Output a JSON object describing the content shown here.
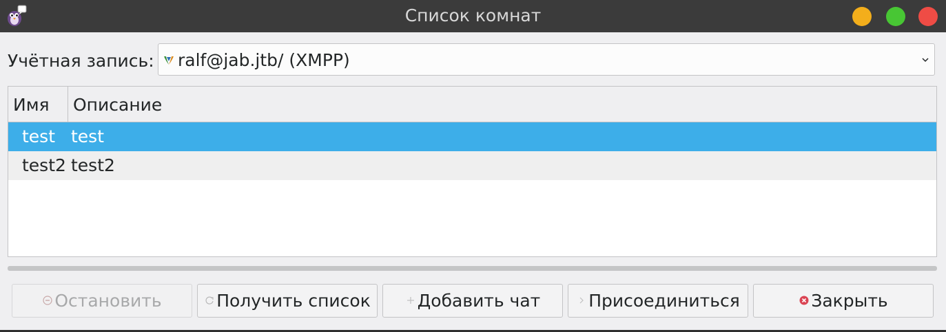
{
  "window": {
    "title": "Список комнат"
  },
  "account": {
    "label": "Учётная запись:",
    "value": "ralf@jab.jtb/ (XMPP)"
  },
  "table": {
    "columns": [
      "Имя",
      "Описание"
    ],
    "rows": [
      {
        "name": "test",
        "description": "test",
        "selected": true
      },
      {
        "name": "test2",
        "description": "test2",
        "selected": false
      }
    ]
  },
  "progress": {
    "fraction": 0
  },
  "buttons": {
    "stop": "Остановить",
    "get_list": "Получить список",
    "add_chat": "Добавить чат",
    "join": "Присоединиться",
    "close": "Закрыть"
  },
  "colors": {
    "selection": "#3daee9",
    "titlebar": "#3b3b3b",
    "minimize": "#f3ae1b",
    "maximize": "#48c634",
    "close": "#ef4c45"
  },
  "icons": {
    "app": "pidgin-icon",
    "account_protocol": "xmpp-icon",
    "stop": "stop-icon",
    "get_list": "refresh-icon",
    "add_chat": "plus-icon",
    "join": "chevron-right-icon",
    "close": "close-circle-icon"
  }
}
